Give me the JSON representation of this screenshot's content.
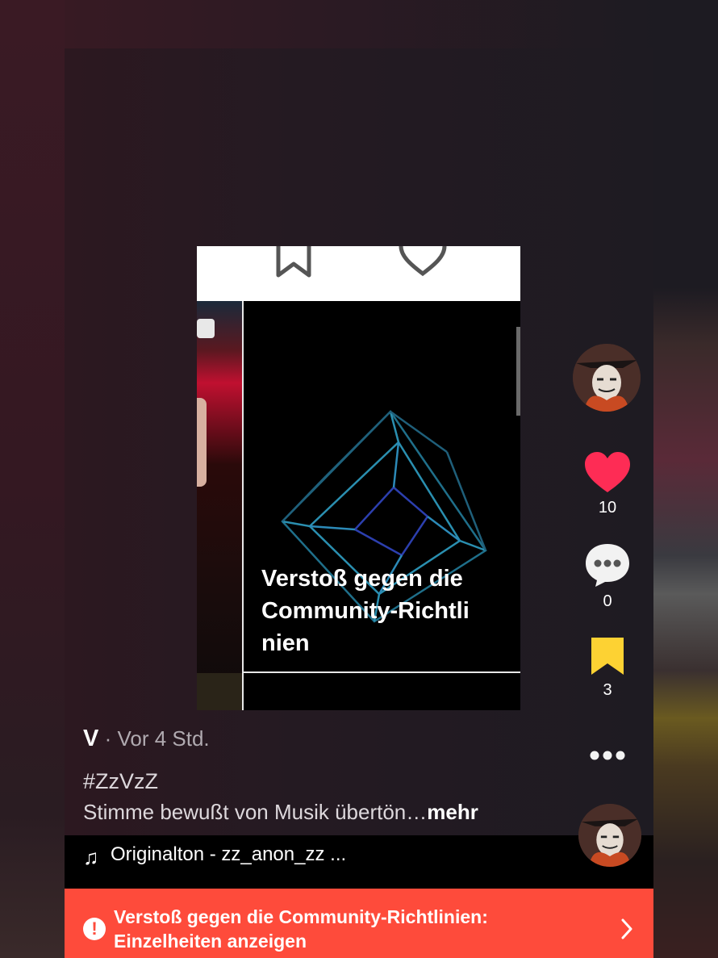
{
  "post": {
    "author": "V",
    "time": " · Vor 4 Std.",
    "hashtag": "#ZzVzZ",
    "description": "Stimme bewußt von Musik übertön…",
    "more_label": "mehr",
    "sound": "Originalton - zz_anon_zz ..."
  },
  "card": {
    "overlay_text": "Verstoß gegen die\nCommunity-Richtli\nnien"
  },
  "actions": {
    "likes": "10",
    "comments": "0",
    "saves": "3"
  },
  "banner": {
    "line1": "Verstoß gegen die Community-Richtlinien:",
    "line2": "Einzelheiten anzeigen"
  },
  "colors": {
    "like": "#fe2c55",
    "save": "#fdd233",
    "banner": "#fe4b3b"
  },
  "icons": [
    "bookmark-outline-icon",
    "heart-outline-icon",
    "heart-icon",
    "comment-icon",
    "bookmark-icon",
    "more-icon",
    "music-note-icon",
    "warning-icon",
    "chevron-right-icon"
  ]
}
